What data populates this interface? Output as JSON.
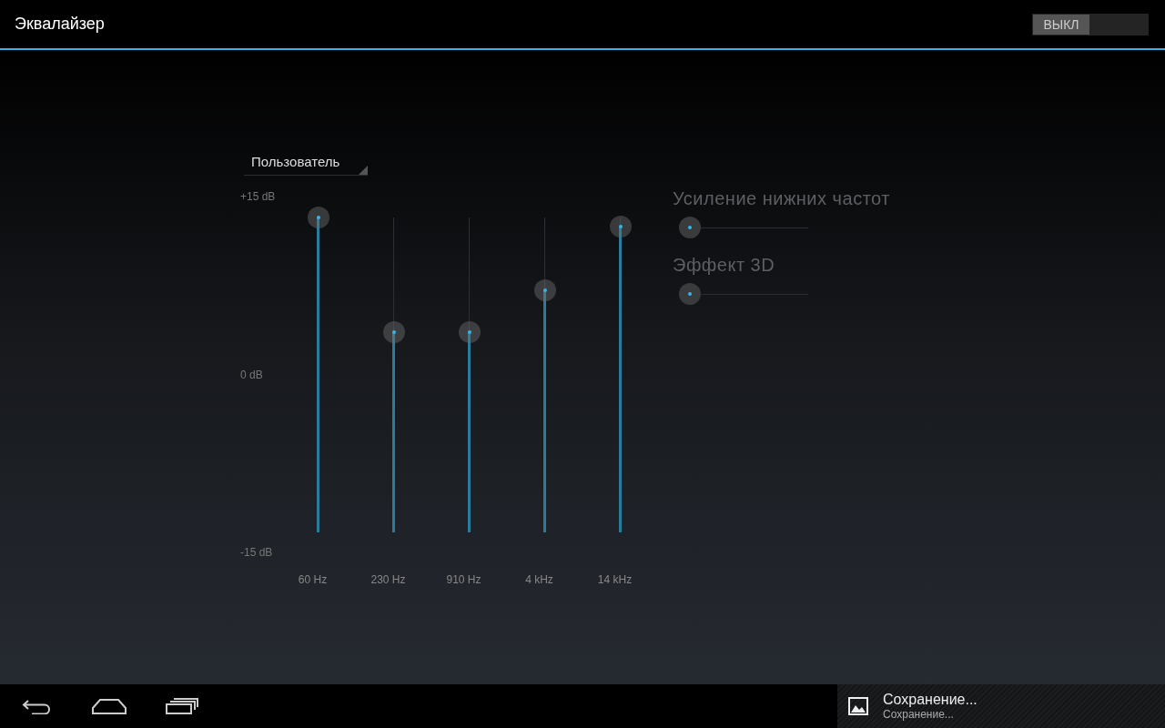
{
  "title": "Эквалайзер",
  "power_switch": {
    "label": "ВЫКЛ",
    "on": false
  },
  "preset": {
    "value": "Пользователь"
  },
  "db_scale": [
    "+15 dB",
    "0 dB",
    "-15 dB"
  ],
  "bands": [
    {
      "label": "60 Hz",
      "level": 1.0
    },
    {
      "label": "230 Hz",
      "level": 0.636
    },
    {
      "label": "910 Hz",
      "level": 0.636
    },
    {
      "label": "4 kHz",
      "level": 0.769
    },
    {
      "label": "14 kHz",
      "level": 0.971
    }
  ],
  "effects": [
    {
      "label": "Усиление нижних частот",
      "level": 0
    },
    {
      "label": "Эффект 3D",
      "level": 0
    }
  ],
  "notification": {
    "title": "Сохранение...",
    "text": "Сохранение..."
  }
}
